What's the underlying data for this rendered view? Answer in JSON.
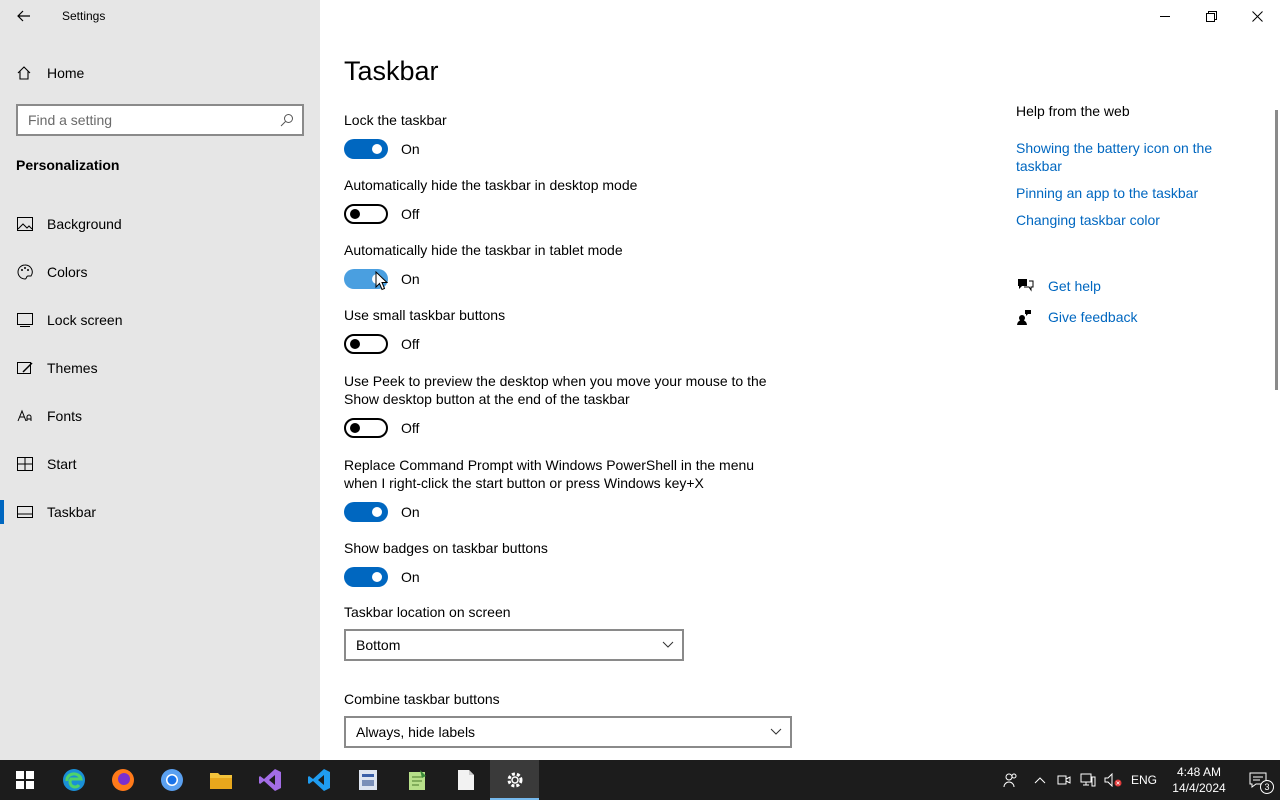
{
  "window": {
    "title": "Settings"
  },
  "sidebar": {
    "home_label": "Home",
    "search_placeholder": "Find a setting",
    "section_title": "Personalization",
    "items": [
      {
        "label": "Background",
        "icon": "picture-icon"
      },
      {
        "label": "Colors",
        "icon": "palette-icon"
      },
      {
        "label": "Lock screen",
        "icon": "lock-screen-icon"
      },
      {
        "label": "Themes",
        "icon": "themes-icon"
      },
      {
        "label": "Fonts",
        "icon": "fonts-icon"
      },
      {
        "label": "Start",
        "icon": "start-icon"
      },
      {
        "label": "Taskbar",
        "icon": "taskbar-icon",
        "active": true
      }
    ]
  },
  "main": {
    "title": "Taskbar",
    "settings": [
      {
        "label": "Lock the taskbar",
        "state": "On"
      },
      {
        "label": "Automatically hide the taskbar in desktop mode",
        "state": "Off"
      },
      {
        "label": "Automatically hide the taskbar in tablet mode",
        "state": "On"
      },
      {
        "label": "Use small taskbar buttons",
        "state": "Off"
      },
      {
        "label": "Use Peek to preview the desktop when you move your mouse to the Show desktop button at the end of the taskbar",
        "state": "Off"
      },
      {
        "label": "Replace Command Prompt with Windows PowerShell in the menu when I right-click the start button or press Windows key+X",
        "state": "On"
      },
      {
        "label": "Show badges on taskbar buttons",
        "state": "On"
      }
    ],
    "location": {
      "label": "Taskbar location on screen",
      "value": "Bottom"
    },
    "combine": {
      "label": "Combine taskbar buttons",
      "value": "Always, hide labels"
    }
  },
  "help": {
    "title": "Help from the web",
    "links": [
      "Showing the battery icon on the taskbar",
      "Pinning an app to the taskbar",
      "Changing taskbar color"
    ],
    "get_help": "Get help",
    "give_feedback": "Give feedback"
  },
  "taskbar": {
    "apps": [
      "start-icon",
      "edge-icon",
      "firefox-icon",
      "chrome-icon",
      "file-explorer-icon",
      "visual-studio-icon",
      "vscode-icon",
      "app-icon",
      "notepadpp-icon",
      "notepad-icon",
      "settings-icon"
    ],
    "language": "ENG",
    "time": "4:48 AM",
    "date": "14/4/2024",
    "notification_count": "3"
  },
  "colors": {
    "accent": "#0067c0",
    "sidebar_bg": "#e6e6e6",
    "taskbar_bg": "#1c1c1c"
  }
}
